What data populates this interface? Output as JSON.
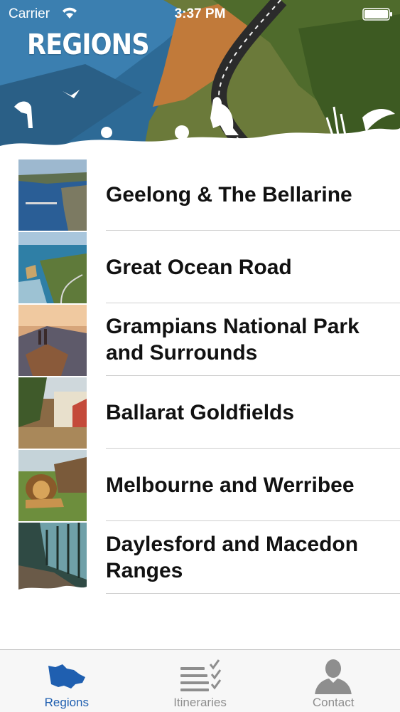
{
  "status_bar": {
    "carrier": "Carrier",
    "time": "3:37 PM"
  },
  "header": {
    "title": "REGIONS"
  },
  "regions": [
    {
      "label": "Geelong & The Bellarine",
      "thumb": "coastal-bay-aerial"
    },
    {
      "label": "Great Ocean Road",
      "thumb": "coastal-cliffs"
    },
    {
      "label": "Grampians National Park and Surrounds",
      "thumb": "mountain-lookout"
    },
    {
      "label": "Ballarat Goldfields",
      "thumb": "historic-street"
    },
    {
      "label": "Melbourne and Werribee",
      "thumb": "lion-zoo"
    },
    {
      "label": "Daylesford and Macedon Ranges",
      "thumb": "glass-bathhouse"
    }
  ],
  "tab_bar": {
    "tabs": [
      {
        "label": "Regions",
        "icon": "victoria-map-icon",
        "active": true
      },
      {
        "label": "Itineraries",
        "icon": "checklist-icon",
        "active": false
      },
      {
        "label": "Contact",
        "icon": "person-icon",
        "active": false
      }
    ],
    "active_color": "#1f5fb0",
    "inactive_color": "#8e8e8e"
  }
}
